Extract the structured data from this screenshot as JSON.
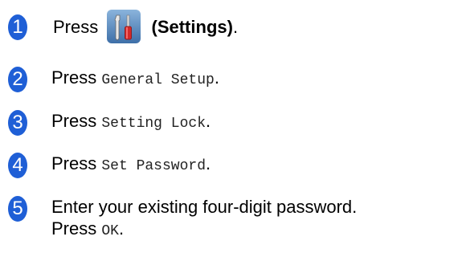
{
  "steps": [
    {
      "number": "1",
      "prefix": "Press",
      "icon": "settings-icon",
      "suffix": "(Settings)",
      "end": "."
    },
    {
      "number": "2",
      "prefix": "Press",
      "code": "General Setup",
      "end": "."
    },
    {
      "number": "3",
      "prefix": "Press",
      "code": "Setting Lock",
      "end": "."
    },
    {
      "number": "4",
      "prefix": "Press",
      "code": "Set Password",
      "end": "."
    },
    {
      "number": "5",
      "line1": "Enter your existing four-digit password.",
      "prefix": "Press",
      "code": "OK",
      "end": "."
    }
  ],
  "colors": {
    "badge": "#1f5fd6",
    "icon_bg": "#5b8ec4"
  }
}
